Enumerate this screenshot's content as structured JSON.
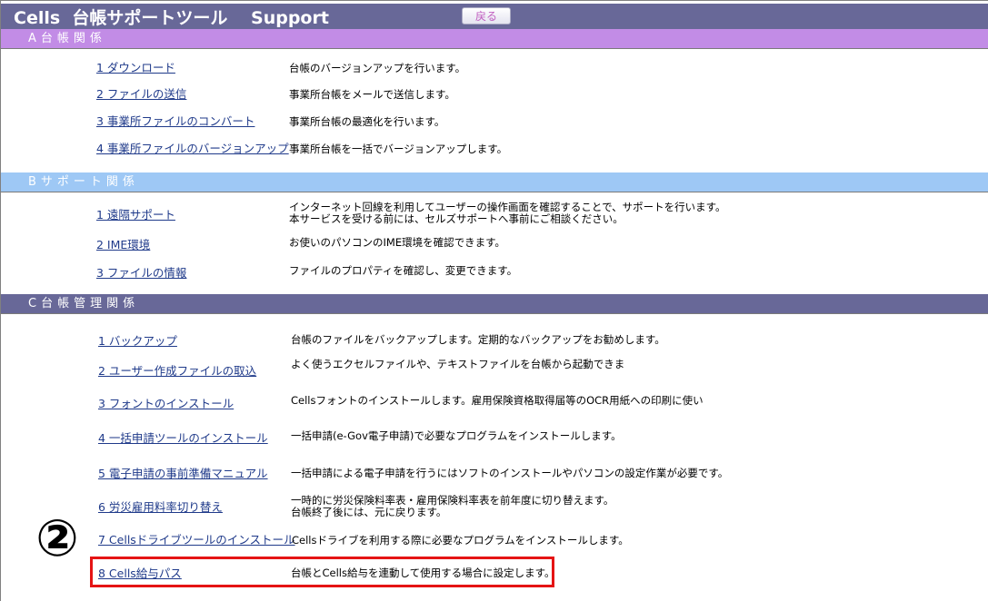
{
  "header": {
    "title": "Cells  台帳サポートツール　 Support",
    "back_label": "戻る"
  },
  "colors": {
    "titlebar": "#686898",
    "section_a": "#c28ce6",
    "section_b": "#9ec8f5",
    "section_c": "#686898",
    "link": "#1f3a8a",
    "highlight": "#e51414"
  },
  "sections": [
    {
      "label": "A台帳関係",
      "items": [
        {
          "link": "1 ダウンロード",
          "desc": [
            "台帳のバージョンアップを行います。"
          ]
        },
        {
          "link": "2 ファイルの送信",
          "desc": [
            "事業所台帳をメールで送信します。"
          ]
        },
        {
          "link": "3 事業所ファイルのコンバート",
          "desc": [
            "事業所台帳の最適化を行います。"
          ]
        },
        {
          "link": "4 事業所ファイルのバージョンアップ",
          "desc": [
            "事業所台帳を一括でバージョンアップします。"
          ]
        }
      ]
    },
    {
      "label": "Bサポート関係",
      "items": [
        {
          "link": "1 遠隔サポート",
          "desc": [
            "インターネット回線を利用してユーザーの操作画面を確認することで、サポートを行います。",
            "本サービスを受ける前には、セルズサポートへ事前にご相談ください。"
          ]
        },
        {
          "link": "2 IME環境",
          "desc": [
            "お使いのパソコンのIME環境を確認できます。"
          ]
        },
        {
          "link": "3 ファイルの情報",
          "desc": [
            "ファイルのプロパティを確認し、変更できます。"
          ]
        }
      ]
    },
    {
      "label": "C台帳管理関係",
      "items": [
        {
          "link": "1 バックアップ",
          "desc": [
            "台帳のファイルをバックアップします。定期的なバックアップをお勧めします。"
          ]
        },
        {
          "link": "2 ユーザー作成ファイルの取込",
          "desc": [
            "よく使うエクセルファイルや、テキストファイルを台帳から起動できま"
          ]
        },
        {
          "link": "3 フォントのインストール",
          "desc": [
            "Cellsフォントのインストールします。雇用保険資格取得届等のOCR用紙への印刷に使い"
          ]
        },
        {
          "link": "4 一括申請ツールのインストール",
          "desc": [
            "一括申請(e-Gov電子申請)で必要なプログラムをインストールします。"
          ]
        },
        {
          "link": "5 電子申請の事前準備マニュアル",
          "desc": [
            "一括申請による電子申請を行うにはソフトのインストールやパソコンの設定作業が必要です。"
          ]
        },
        {
          "link": "6 労災雇用料率切り替え",
          "desc": [
            "一時的に労災保険料率表・雇用保険料率表を前年度に切り替えます。",
            "台帳終了後には、元に戻ります。"
          ]
        },
        {
          "link": "7 Cellsドライブツールのインストール",
          "desc": [
            "Cellsドライブを利用する際に必要なプログラムをインストールします。"
          ]
        },
        {
          "link": "8 Cells給与パス",
          "desc": [
            "台帳とCells給与を連動して使用する場合に設定します。"
          ]
        }
      ]
    }
  ],
  "annotation": {
    "marker": "②"
  }
}
